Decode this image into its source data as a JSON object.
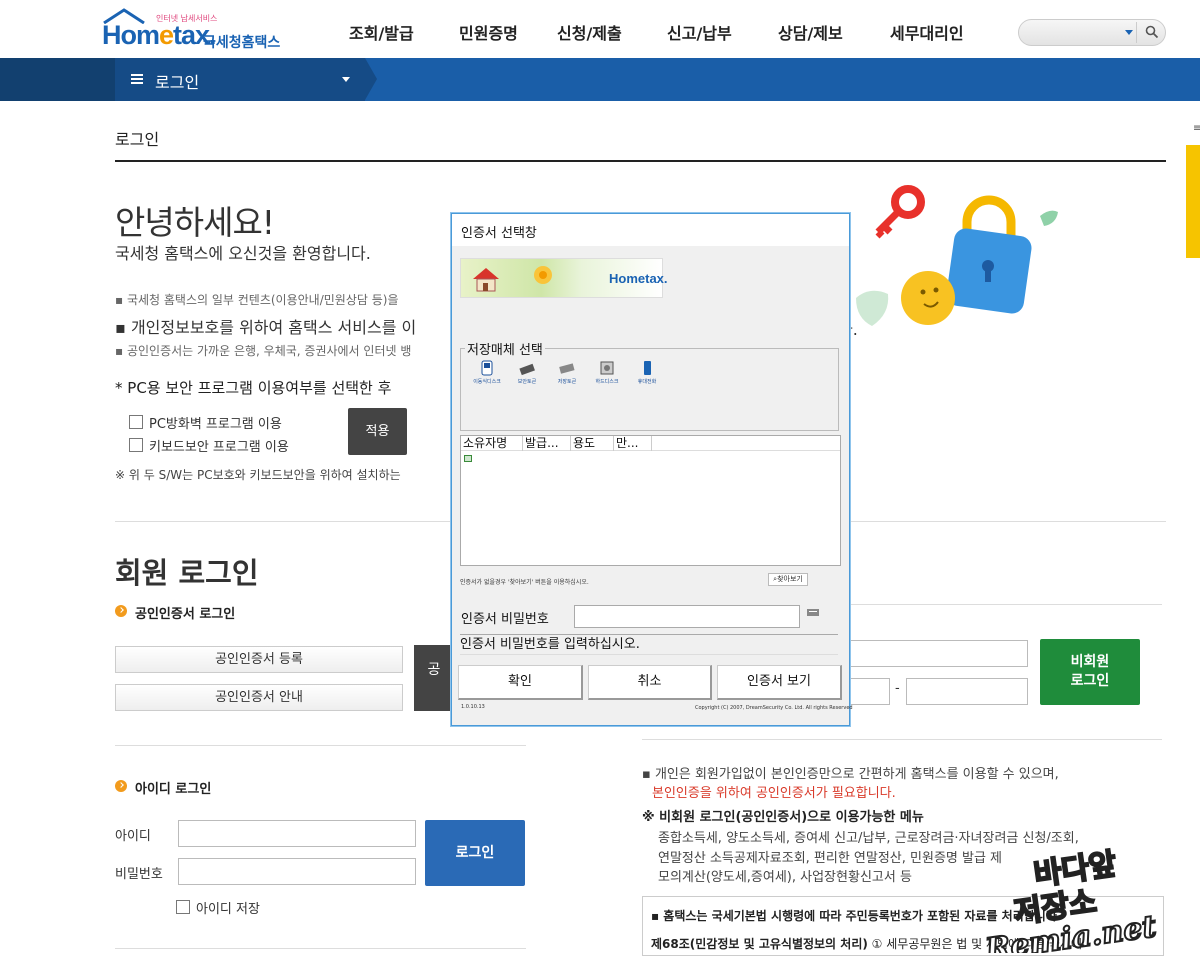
{
  "header": {
    "logo_small": "인터넷 납세서비스",
    "logo_brand_a": "Hom",
    "logo_brand_b": "e",
    "logo_brand_c": "tax.",
    "logo_korean": "국세청홈택스",
    "nav": [
      "조회/발급",
      "민원증명",
      "신청/제출",
      "신고/납부",
      "상담/제보",
      "세무대리인"
    ],
    "search_icon": "search-icon"
  },
  "menubar": {
    "label": "로그인"
  },
  "page": {
    "title": "로그인",
    "hello": "안녕하세요!",
    "welcome": "국세청 홈택스에 오신것을 환영합니다.",
    "notes": [
      "국세청 홈택스의 일부 컨텐츠(이용안내/민원상담 등)을",
      "개인정보보호를 위하여 홈택스 서비스를 이",
      "공인인증서는 가까운 은행, 우체국, 증권사에서 인터넷 뱅"
    ],
    "note_tail": "다.",
    "pc_title": "* PC용 보안 프로그램 이용여부를 선택한 후",
    "pc_opt1": "PC방화벽 프로그램 이용",
    "pc_opt2": "키보드보안 프로그램 이용",
    "apply": "적용",
    "sw_note": "※ 위 두 S/W는 PC보호와 키보드보안을 위하여 설치하는"
  },
  "member": {
    "title": "회원 로그인",
    "cert_title": "공인인증서 로그인",
    "cert_register": "공인인증서 등록",
    "cert_guide": "공인인증서 안내",
    "cert_login_partial": "공",
    "id_title": "아이디 로그인",
    "id_label": "아이디",
    "pw_label": "비밀번호",
    "login": "로그인",
    "save_id": "아이디 저장"
  },
  "nonmember": {
    "button_line1": "비회원",
    "button_line2": "로그인",
    "dash": "-",
    "note1": "개인은 회원가입없이 본인인증만으로 간편하게 홈택스를 이용할 수 있으며,",
    "note2": "본인인증을 위하여 공인인증서가 필요합니다.",
    "menu_title": "※ 비회원 로그인(공인인증서)으로 이용가능한 메뉴",
    "menu1": "종합소득세, 양도소득세, 증여세 신고/납부, 근로장려금·자녀장려금 신청/조회,",
    "menu2": "연말정산 소득공제자료조회, 편리한 연말정산, 민원증명 발급 제",
    "menu3": "모의계산(양도세,증여세), 사업장현황신고서 등",
    "box1": "▪ 홈택스는 국세기본법 시행령에 따라 주민등록번호가 포함된 자료를 처리합니다",
    "box2a": "제68조(민감정보 및 고유식별정보의 처리)",
    "box2b": "① 세무공무원은 법 및 세법에 따른 국세에"
  },
  "dialog": {
    "title": "인증서 선택창",
    "banner_logo": "Hometax.",
    "group_label": "저장매체 선택",
    "media": [
      {
        "label": "이동식디스크",
        "icon": "usb-disk-icon"
      },
      {
        "label": "보안토큰",
        "icon": "security-token-icon"
      },
      {
        "label": "저장토큰",
        "icon": "storage-token-icon"
      },
      {
        "label": "하드디스크",
        "icon": "hard-disk-icon"
      },
      {
        "label": "휴대전화",
        "icon": "mobile-phone-icon"
      }
    ],
    "columns": [
      "소유자명",
      "발급...",
      "용도",
      "만..."
    ],
    "hint": "인증서가 없을경우 '찾아보기' 버튼을 이용하십시오.",
    "find": "찾아보기",
    "pw_label": "인증서 비밀번호",
    "status": "인증서 비밀번호를 입력하십시오.",
    "ok": "확인",
    "cancel": "취소",
    "view": "인증서 보기",
    "version": "1.0.10.13",
    "copyright": "Copyright (C) 2007, DreamSecurity Co. Ltd. All rights Reserved"
  },
  "watermark": {
    "line1": "바다앞",
    "line2": "저장소",
    "line3": "Remia.net"
  },
  "colors": {
    "brand_blue": "#1a63b3",
    "nav_bar": "#1a5ea8",
    "login_blue": "#2a6ab6",
    "nonmember_green": "#1f8c3b",
    "accent_orange": "#f29b1d"
  }
}
